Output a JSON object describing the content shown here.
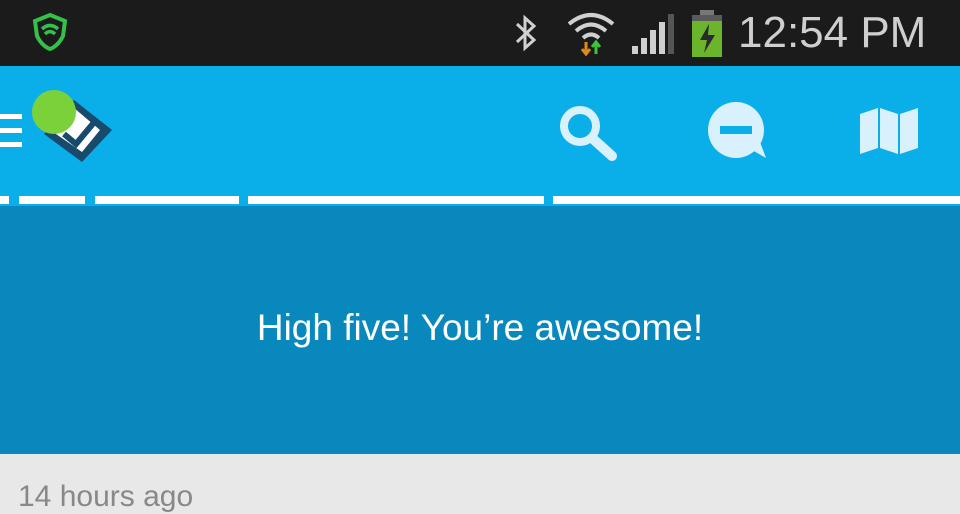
{
  "status_bar": {
    "time": "12:54 PM",
    "icons": [
      "shield-icon",
      "bluetooth-icon",
      "wifi-icon",
      "signal-icon",
      "battery-charging-icon"
    ]
  },
  "app_bar": {
    "icons": [
      "menu-icon",
      "app-logo",
      "search-icon",
      "chat-icon",
      "map-icon"
    ],
    "accent_color": "#0aaee9"
  },
  "banner": {
    "message": "High five! You’re awesome!",
    "color": "#0888bd"
  },
  "feed": {
    "timestamp": "14 hours ago"
  }
}
